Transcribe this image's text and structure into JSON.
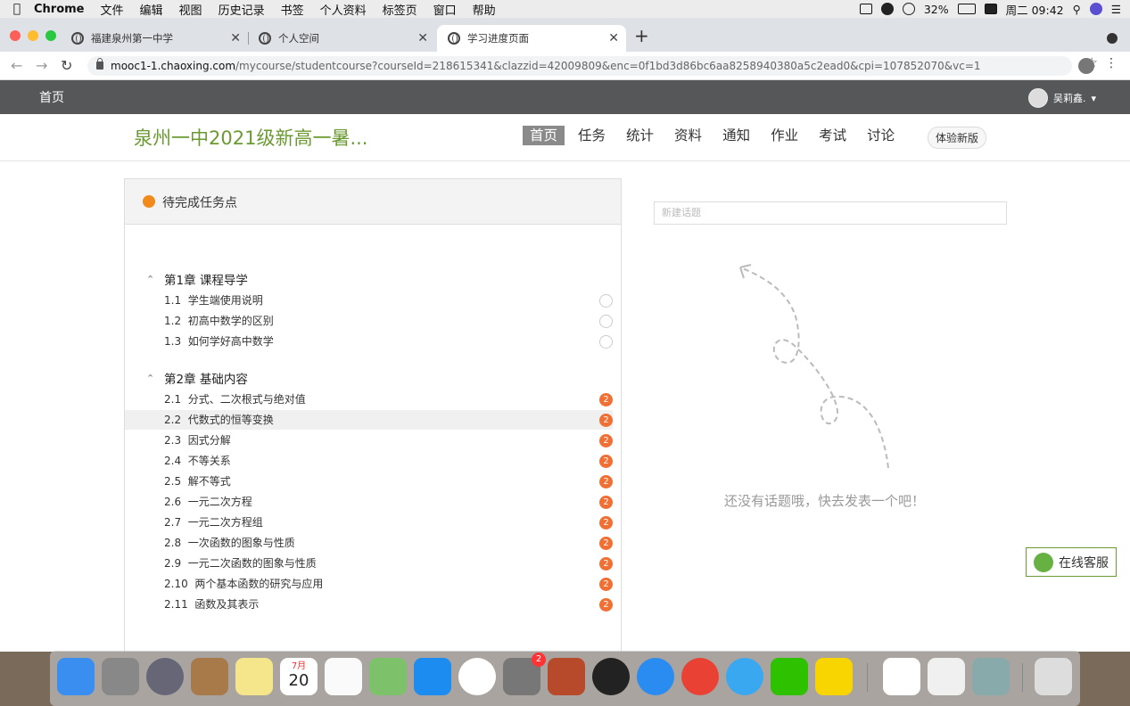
{
  "menubar": {
    "app": "Chrome",
    "items": [
      "文件",
      "编辑",
      "视图",
      "历史记录",
      "书签",
      "个人资料",
      "标签页",
      "窗口",
      "帮助"
    ],
    "battery": "32%",
    "datetime": "周二 09:42"
  },
  "tabs": [
    {
      "title": "福建泉州第一中学",
      "active": false
    },
    {
      "title": "个人空间",
      "active": false
    },
    {
      "title": "学习进度页面",
      "active": true
    }
  ],
  "address": {
    "host": "mooc1-1.chaoxing.com",
    "path": "/mycourse/studentcourse?courseId=218615341&clazzid=42009809&enc=0f1bd3d86bc6aa8258940380a5c2ead0&cpi=107852070&vc=1"
  },
  "topnav": {
    "home": "首页",
    "user": "吴莉鑫."
  },
  "course": {
    "title": "泉州一中2021级新高一暑...",
    "nav": [
      "首页",
      "任务",
      "统计",
      "资料",
      "通知",
      "作业",
      "考试",
      "讨论"
    ],
    "active_nav": "首页",
    "new_version": "体验新版"
  },
  "tasks": {
    "title": "待完成任务点",
    "chapters": [
      {
        "title": "第1章 课程导学",
        "items": [
          {
            "num": "1.1",
            "label": "学生端使用说明",
            "status": ""
          },
          {
            "num": "1.2",
            "label": "初高中数学的区别",
            "status": ""
          },
          {
            "num": "1.3",
            "label": "如何学好高中数学",
            "status": ""
          }
        ]
      },
      {
        "title": "第2章 基础内容",
        "items": [
          {
            "num": "2.1",
            "label": "分式、二次根式与绝对值",
            "status": "2"
          },
          {
            "num": "2.2",
            "label": "代数式的恒等变换",
            "status": "2"
          },
          {
            "num": "2.3",
            "label": "因式分解",
            "status": "2"
          },
          {
            "num": "2.4",
            "label": "不等关系",
            "status": "2"
          },
          {
            "num": "2.5",
            "label": "解不等式",
            "status": "2"
          },
          {
            "num": "2.6",
            "label": "一元二次方程",
            "status": "2"
          },
          {
            "num": "2.7",
            "label": "一元二次方程组",
            "status": "2"
          },
          {
            "num": "2.8",
            "label": "一次函数的图象与性质",
            "status": "2"
          },
          {
            "num": "2.9",
            "label": "一元二次函数的图象与性质",
            "status": "2"
          },
          {
            "num": "2.10",
            "label": "两个基本函数的研究与应用",
            "status": "2"
          },
          {
            "num": "2.11",
            "label": "函数及其表示",
            "status": "2"
          }
        ]
      }
    ]
  },
  "discussion": {
    "placeholder": "新建话题",
    "empty": "还没有话题哦，快去发表一个吧！"
  },
  "service": "在线客服",
  "dock": {
    "calendar_month": "7月",
    "calendar_day": "20",
    "settings_badge": "2"
  },
  "colors": {
    "accent_green": "#6b9a33",
    "badge_orange": "#f16f32",
    "topnav_bg": "#555759"
  }
}
